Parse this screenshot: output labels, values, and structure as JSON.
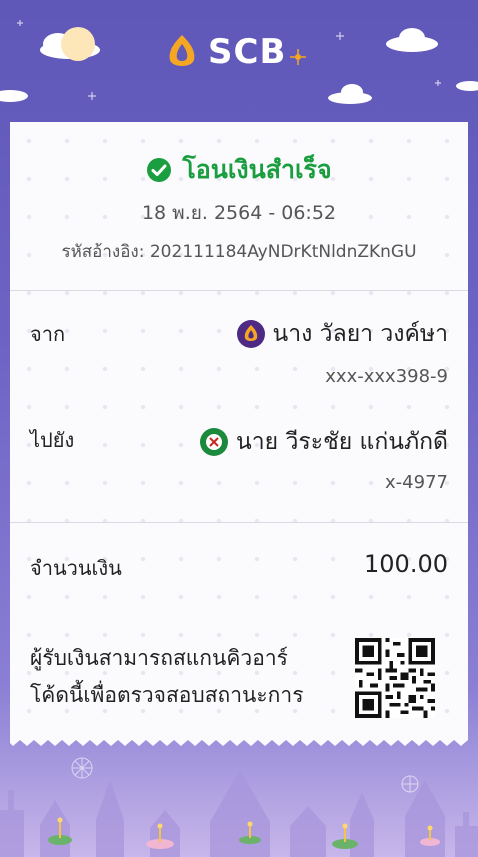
{
  "brand": {
    "name": "SCB",
    "accent": "#f5a623"
  },
  "status": {
    "title": "โอนเงินสำเร็จ",
    "icon": "check-circle-icon",
    "color": "#1a9e3f"
  },
  "datetime": "18 พ.ย. 2564 - 06:52",
  "reference": "รหัสอ้างอิง: 202111184AyNDrKtNldnZKnGU",
  "from": {
    "label": "จาก",
    "name": "นาง วัลยา วงค์ษา",
    "account": "xxx-xxx398-9",
    "bank_icon": "scb-bank-icon"
  },
  "to": {
    "label": "ไปยัง",
    "name": "นาย วีระชัย แก่นภักดี",
    "account": "x-4977",
    "bank_icon": "kbank-icon"
  },
  "amount": {
    "label": "จำนวนเงิน",
    "value": "100.00"
  },
  "qr_note": {
    "line1": "ผู้รับเงินสามารถสแกนคิวอาร์",
    "line2": "โค้ดนี้เพื่อตรวจสอบสถานะการ"
  }
}
